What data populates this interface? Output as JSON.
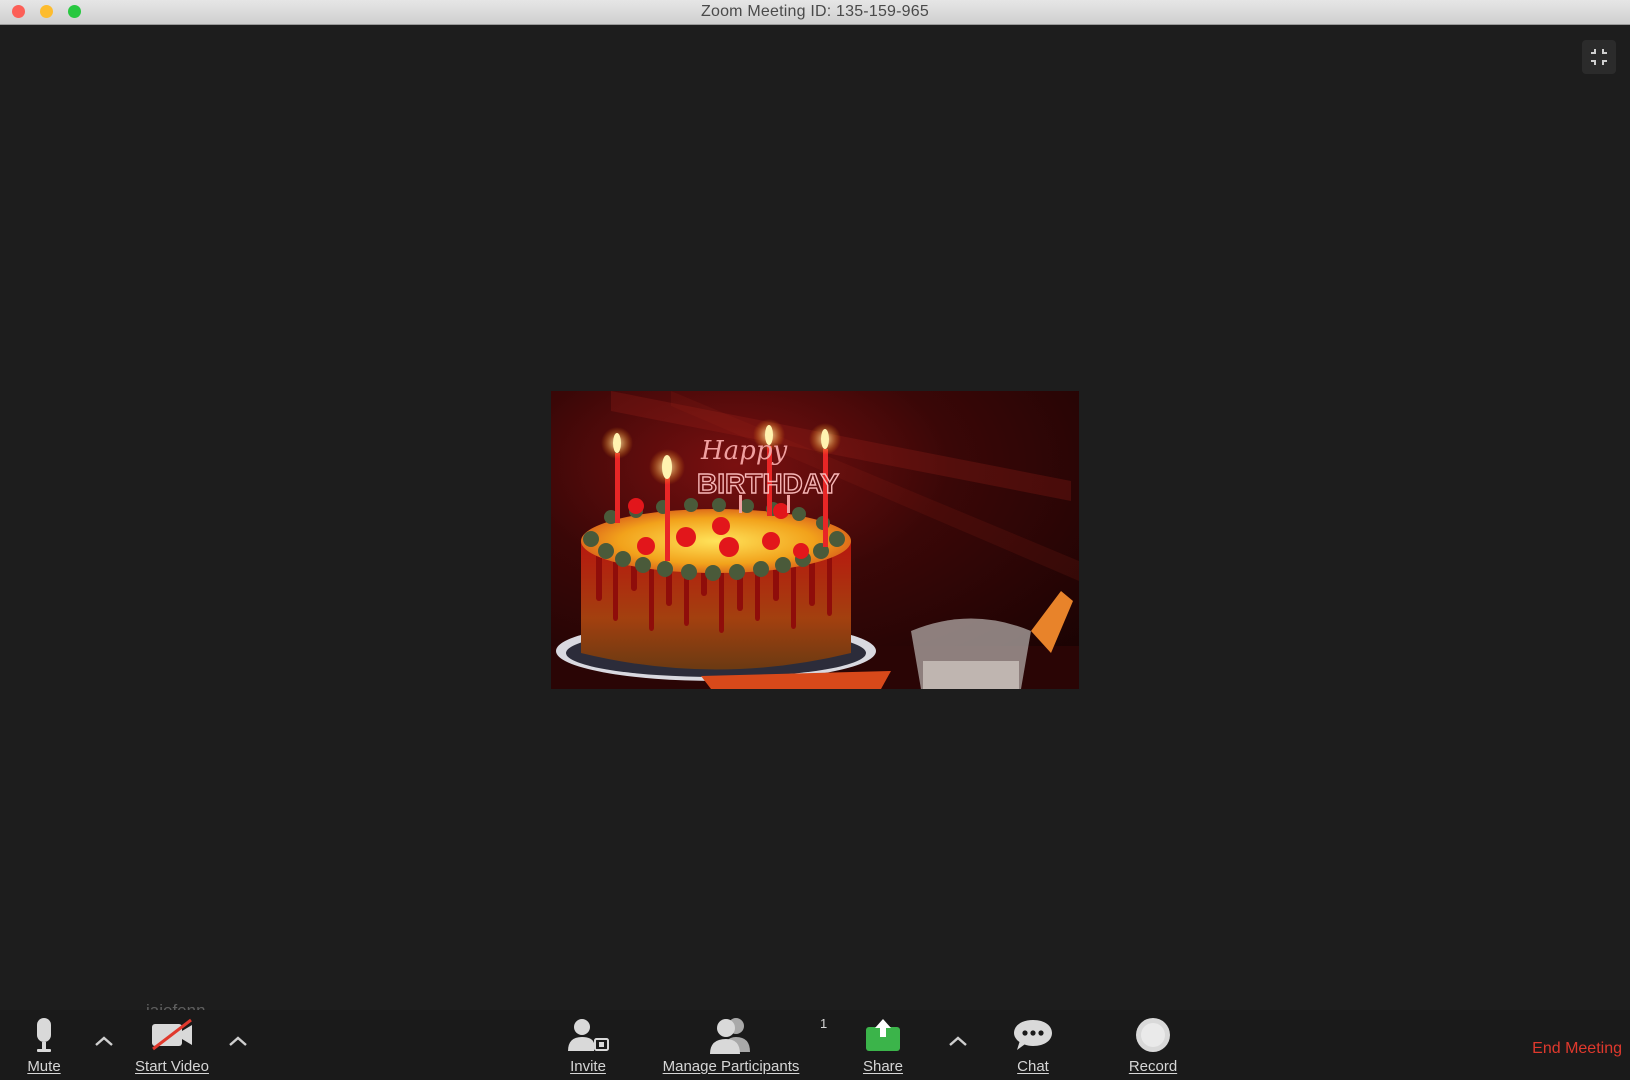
{
  "window": {
    "title": "Zoom Meeting ID: 135-159-965"
  },
  "share": {
    "topper_line1": "Happy",
    "topper_line2": "BIRTHDAY"
  },
  "participant": {
    "name": "jaiefenn"
  },
  "toolbar": {
    "mute_label": "Mute",
    "start_video_label": "Start Video",
    "invite_label": "Invite",
    "manage_participants_label": "Manage Participants",
    "participants_count": "1",
    "share_label": "Share",
    "chat_label": "Chat",
    "record_label": "Record",
    "end_meeting_label": "End Meeting"
  },
  "colors": {
    "share_green": "#3bb44a",
    "end_red": "#e0392d",
    "video_off_red": "#e0392d"
  }
}
